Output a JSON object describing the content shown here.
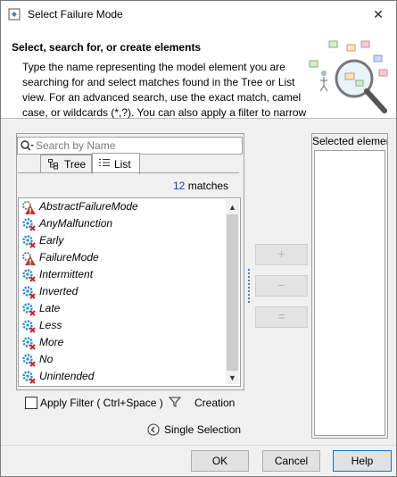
{
  "window": {
    "title": "Select Failure Mode",
    "close_glyph": "✕"
  },
  "header": {
    "title": "Select, search for, or create elements",
    "description": "Type the name representing the model element you are searching for and select matches found in the Tree or List view. For an advanced search, use the exact match, camel case, or wildcards (*,?). You can also apply a filter to narrow"
  },
  "search": {
    "placeholder": "Search by Name"
  },
  "tabs": [
    {
      "label": "Tree"
    },
    {
      "label": "List"
    }
  ],
  "matches": {
    "count": "12",
    "label": "matches"
  },
  "list": {
    "items": [
      {
        "label": "AbstractFailureMode",
        "icon": "warning-icon"
      },
      {
        "label": "AnyMalfunction",
        "icon": "gear-x-icon"
      },
      {
        "label": "Early",
        "icon": "gear-x-icon"
      },
      {
        "label": "FailureMode",
        "icon": "warning-icon"
      },
      {
        "label": "Intermittent",
        "icon": "gear-x-icon"
      },
      {
        "label": "Inverted",
        "icon": "gear-x-icon"
      },
      {
        "label": "Late",
        "icon": "gear-x-icon"
      },
      {
        "label": "Less",
        "icon": "gear-x-icon"
      },
      {
        "label": "More",
        "icon": "gear-x-icon"
      },
      {
        "label": "No",
        "icon": "gear-x-icon"
      },
      {
        "label": "Unintended",
        "icon": "gear-x-icon"
      }
    ]
  },
  "side_buttons": {
    "add": "+",
    "remove": "−",
    "remove_all": "="
  },
  "filter": {
    "label": "Apply Filter ( Ctrl+Space )",
    "creation": "Creation"
  },
  "selection_mode": {
    "label": "Single Selection"
  },
  "selected_panel": {
    "title": "Selected elemer"
  },
  "buttons": {
    "ok": "OK",
    "cancel": "Cancel",
    "help": "Help"
  }
}
